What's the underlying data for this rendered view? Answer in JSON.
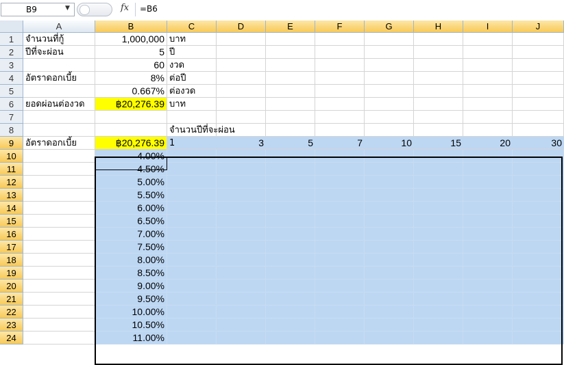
{
  "formula_bar": {
    "name_box": "B9",
    "fx_label": "fx",
    "formula": "=B6"
  },
  "columns": [
    "A",
    "B",
    "C",
    "D",
    "E",
    "F",
    "G",
    "H",
    "I",
    "J"
  ],
  "rows": [
    {
      "num": "1",
      "A": "จำนวนที่กู้",
      "B": "1,000,000",
      "C": "บาท"
    },
    {
      "num": "2",
      "A": "ปีที่จะผ่อน",
      "B": "5",
      "C": "ปี"
    },
    {
      "num": "3",
      "A": "",
      "B": "60",
      "C": "งวด"
    },
    {
      "num": "4",
      "A": "อัตราดอกเบี้ย",
      "B": "8%",
      "C": "ต่อปี"
    },
    {
      "num": "5",
      "A": "",
      "B": "0.667%",
      "C": "ต่องวด"
    },
    {
      "num": "6",
      "A": "ยอดผ่อนต่องวด",
      "B": "฿20,276.39",
      "C": "บาท"
    },
    {
      "num": "7",
      "A": "",
      "B": "",
      "C": ""
    },
    {
      "num": "8",
      "A": "",
      "B": "",
      "C": "จำนวนปีที่จะผ่อน"
    },
    {
      "num": "9",
      "A": "อัตราดอกเบี้ย",
      "B": "฿20,276.39",
      "C": "1",
      "D": "3",
      "E": "5",
      "F": "7",
      "G": "10",
      "H": "15",
      "I": "20",
      "J": "30"
    },
    {
      "num": "10",
      "B": "4.00%"
    },
    {
      "num": "11",
      "B": "4.50%"
    },
    {
      "num": "12",
      "B": "5.00%"
    },
    {
      "num": "13",
      "B": "5.50%"
    },
    {
      "num": "14",
      "B": "6.00%"
    },
    {
      "num": "15",
      "B": "6.50%"
    },
    {
      "num": "16",
      "B": "7.00%"
    },
    {
      "num": "17",
      "B": "7.50%"
    },
    {
      "num": "18",
      "B": "8.00%"
    },
    {
      "num": "19",
      "B": "8.50%"
    },
    {
      "num": "20",
      "B": "9.00%"
    },
    {
      "num": "21",
      "B": "9.50%"
    },
    {
      "num": "22",
      "B": "10.00%"
    },
    {
      "num": "23",
      "B": "10.50%"
    },
    {
      "num": "24",
      "B": "11.00%"
    }
  ],
  "colors": {
    "highlight_yellow": "#ffff00",
    "selection_blue": "#bdd7f3",
    "header_selected": "#f8c957"
  }
}
